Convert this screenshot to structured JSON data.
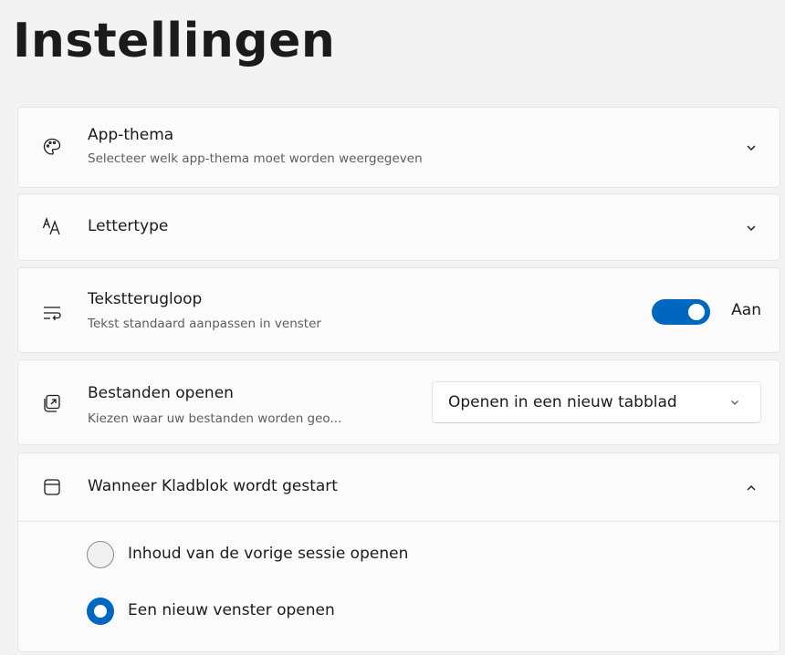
{
  "page": {
    "title": "Instellingen"
  },
  "settings": {
    "app_theme": {
      "title": "App-thema",
      "subtitle": "Selecteer welk app-thema moet worden weergegeven",
      "icon": "palette-icon"
    },
    "font": {
      "title": "Lettertype",
      "icon": "font-icon"
    },
    "word_wrap": {
      "title": "Tekstterugloop",
      "subtitle": "Tekst standaard aanpassen in venster",
      "icon": "word-wrap-icon",
      "toggle_on": true,
      "toggle_label": "Aan"
    },
    "open_files": {
      "title": "Bestanden openen",
      "subtitle": "Kiezen waar uw bestanden worden geo...",
      "icon": "open-in-new-icon",
      "selected": "Openen in een nieuw tabblad"
    },
    "on_start": {
      "title": "Wanneer Kladblok wordt gestart",
      "icon": "window-icon",
      "expanded": true,
      "options": [
        {
          "label": "Inhoud van de vorige sessie openen",
          "selected": false
        },
        {
          "label": "Een nieuw venster openen",
          "selected": true
        }
      ]
    }
  },
  "colors": {
    "accent": "#0067c0",
    "background": "#f3f3f3",
    "card": "#fbfbfb"
  }
}
